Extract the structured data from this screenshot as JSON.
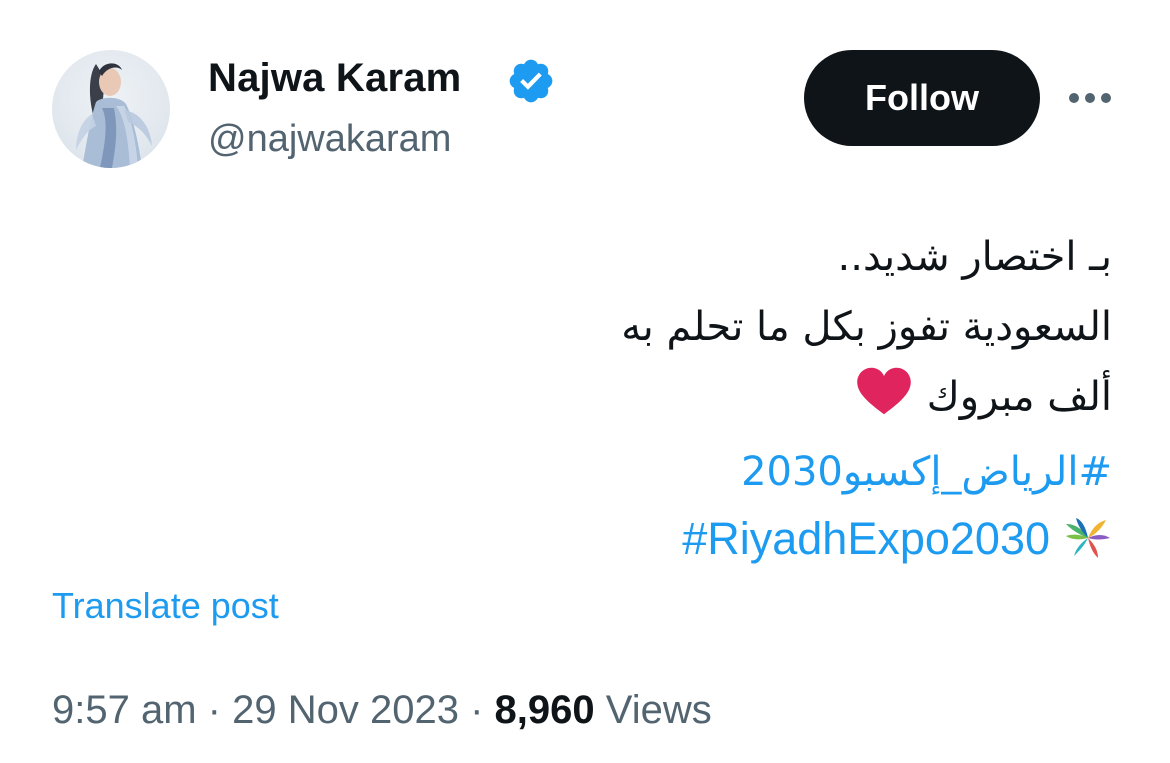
{
  "author": {
    "display_name": "Najwa Karam",
    "handle": "@najwakaram",
    "verified": true,
    "verified_color": "#1d9bf0"
  },
  "actions": {
    "follow_label": "Follow",
    "more_icon": "more-horizontal-icon"
  },
  "tweet": {
    "lines": [
      "بـ اختصار شديد..",
      "السعودية تفوز بكل ما تحلم به",
      "ألف مبروك"
    ],
    "heart_icon": "red-heart-emoji",
    "heart_color": "#e0245e",
    "hashtag_ar": "#الرياض_إكسبو2030",
    "hashtag_en": "#RiyadhExpo2030",
    "hashtag_emoji_icon": "riyadh-expo-palm-emoji",
    "hashtag_color": "#1d9bf0"
  },
  "translate_label": "Translate post",
  "meta": {
    "time": "9:57 am",
    "separator": "·",
    "date": "29 Nov 2023",
    "views_count": "8,960",
    "views_label": "Views"
  }
}
